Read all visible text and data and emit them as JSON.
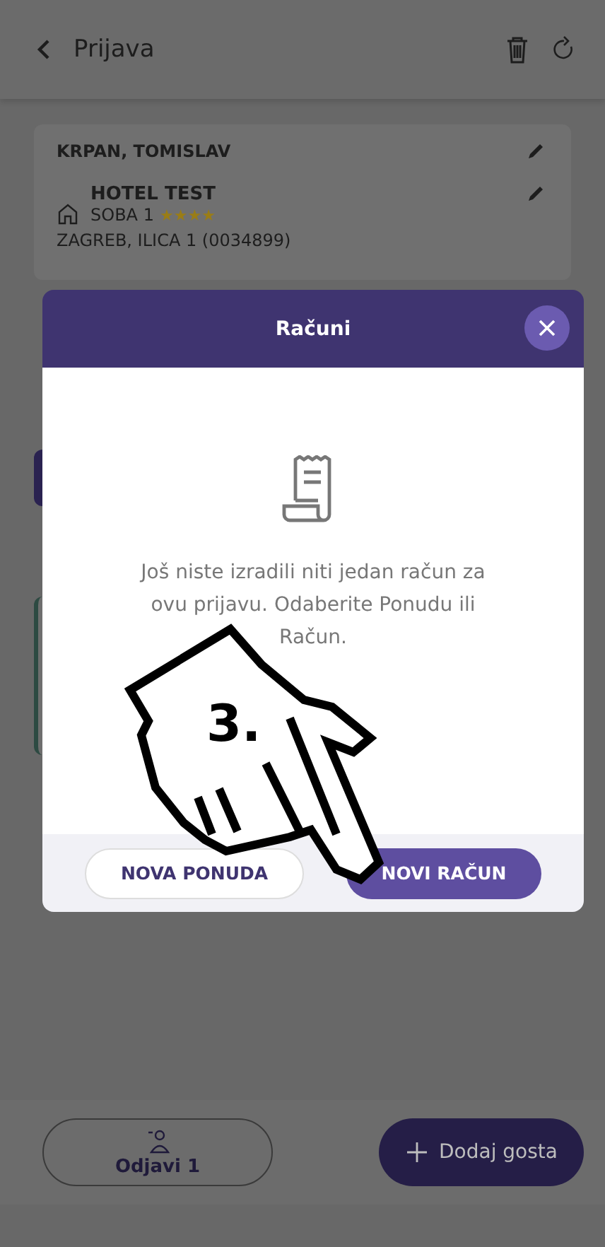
{
  "header": {
    "title": "Prijava"
  },
  "guest": {
    "name": "KRPAN, TOMISLAV"
  },
  "accommodation": {
    "hotel": "HOTEL TEST",
    "room": "SOBA 1",
    "stars": 4,
    "address": "ZAGREB, ILICA 1 (0034899)"
  },
  "modal": {
    "title": "Računi",
    "message": "Još niste izradili niti jedan račun za ovu prijavu. Odaberite Ponudu ili Račun.",
    "buttons": [
      {
        "label": "NOVA PONUDA",
        "kind": "outline"
      },
      {
        "label": "NOVI RAČUN",
        "kind": "primary"
      }
    ]
  },
  "annotation": {
    "step": "3."
  },
  "bottom_bar": {
    "buttons": [
      {
        "label": "Odjavi 1",
        "kind": "outline"
      },
      {
        "label": "Dodaj gosta",
        "kind": "primary"
      }
    ]
  }
}
